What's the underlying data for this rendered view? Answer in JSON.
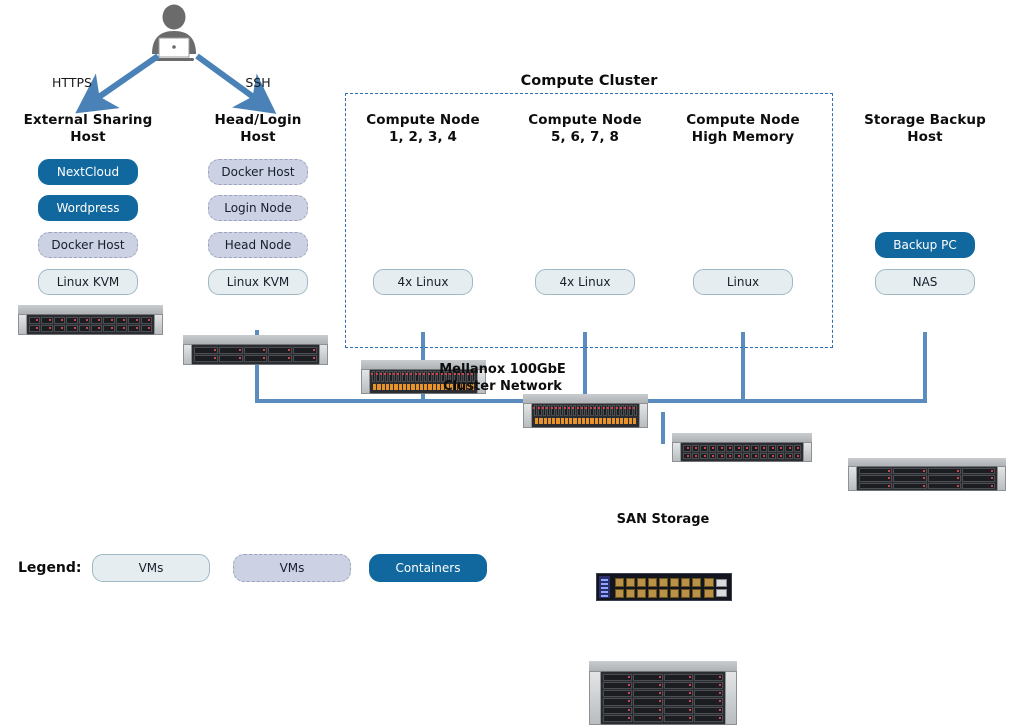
{
  "diagram": {
    "title_cluster": "Compute Cluster",
    "user": {
      "icon": "person-with-laptop-icon"
    },
    "links": [
      {
        "name": "https-link",
        "label": "HTTPS"
      },
      {
        "name": "ssh-link",
        "label": "SSH"
      }
    ],
    "columns": [
      {
        "id": "external-sharing-host",
        "title_line1": "External Sharing",
        "title_line2": "Host",
        "stack": [
          {
            "label": "NextCloud",
            "kind": "container"
          },
          {
            "label": "Wordpress",
            "kind": "container"
          },
          {
            "label": "Docker Host",
            "kind": "vm-dashed"
          },
          {
            "label": "Linux KVM",
            "kind": "vm-solid"
          }
        ],
        "hardware": "1u-server-icon"
      },
      {
        "id": "head-login-host",
        "title_line1": "Head/Login",
        "title_line2": "Host",
        "stack": [
          {
            "label": "Docker Host",
            "kind": "vm-dashed"
          },
          {
            "label": "Login Node",
            "kind": "vm-dashed"
          },
          {
            "label": "Head Node",
            "kind": "vm-dashed"
          },
          {
            "label": "Linux KVM",
            "kind": "vm-solid"
          }
        ],
        "hardware": "1u-server-icon"
      },
      {
        "id": "compute-node-1-4",
        "title_line1": "Compute Node",
        "title_line2": "1, 2, 3, 4",
        "stack": [
          {
            "label": "4x Linux",
            "kind": "vm-solid"
          }
        ],
        "hardware": "2u-server-icon"
      },
      {
        "id": "compute-node-5-8",
        "title_line1": "Compute Node",
        "title_line2": "5, 6, 7, 8",
        "stack": [
          {
            "label": "4x Linux",
            "kind": "vm-solid"
          }
        ],
        "hardware": "2u-server-icon"
      },
      {
        "id": "compute-node-high-memory",
        "title_line1": "Compute Node",
        "title_line2": "High Memory",
        "stack": [
          {
            "label": "Linux",
            "kind": "vm-solid"
          }
        ],
        "hardware": "1u-server-icon"
      },
      {
        "id": "storage-backup-host",
        "title_line1": "Storage Backup",
        "title_line2": "Host",
        "stack": [
          {
            "label": "Backup PC",
            "kind": "container"
          },
          {
            "label": "NAS",
            "kind": "vm-solid"
          }
        ],
        "hardware": "2u-storage-icon"
      }
    ],
    "network": {
      "label_line1": "Mellanox 100GbE",
      "label_line2": "Cluster Network",
      "switch_icon": "network-switch-icon"
    },
    "storage": {
      "label": "SAN Storage",
      "icon": "4u-storage-array-icon"
    },
    "legend": {
      "word": "Legend:",
      "items": [
        {
          "label": "VMs",
          "kind": "vm-solid"
        },
        {
          "label": "VMs",
          "kind": "vm-dashed"
        },
        {
          "label": "Containers",
          "kind": "container"
        }
      ]
    },
    "colors": {
      "container_blue": "#11689f",
      "vm_dashed_fill": "#ccd1e4",
      "vm_solid_fill": "#e6edf0",
      "wire_blue": "#5b8cc0",
      "cluster_border": "#2f6fb5",
      "person_gray": "#6b6b6b"
    }
  }
}
